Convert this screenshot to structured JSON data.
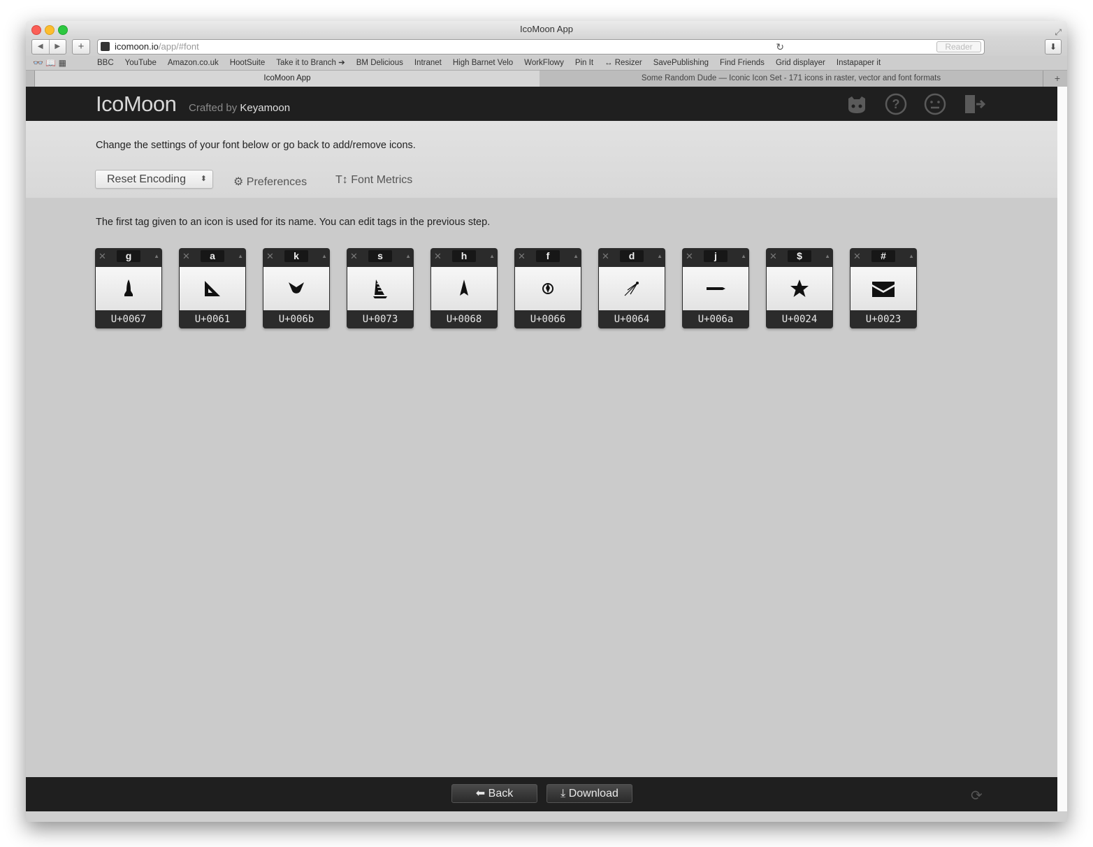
{
  "window": {
    "title": "IcoMoon App"
  },
  "browser": {
    "url_host": "icomoon.io",
    "url_path": "/app/#font",
    "reader_label": "Reader",
    "bookmarks": [
      "BBC",
      "YouTube",
      "Amazon.co.uk",
      "HootSuite",
      "Take it to Branch ➔",
      "BM Delicious",
      "Intranet",
      "High Barnet Velo",
      "WorkFlowy",
      "Pin It",
      "↔ Resizer",
      "SavePublishing",
      "Find Friends",
      "Grid displayer",
      "Instapaper it"
    ],
    "tabs": [
      {
        "label": "IcoMoon App"
      },
      {
        "label": "Some Random Dude — Iconic Icon Set - 171 icons in raster, vector and font formats"
      }
    ]
  },
  "header": {
    "logo": "IcoMoon",
    "crafted_by": "Crafted by",
    "author": "Keyamoon"
  },
  "settings": {
    "intro": "Change the settings of your font below or go back to add/remove icons.",
    "encoding_select": "Reset Encoding",
    "preferences_label": "Preferences",
    "font_metrics_label": "Font Metrics"
  },
  "content": {
    "intro": "The first tag given to an icon is used for its name. You can edit tags in the previous step.",
    "glyphs": [
      {
        "tag": "g",
        "code": "U+0067",
        "icon": "rocket-icon"
      },
      {
        "tag": "a",
        "code": "U+0061",
        "icon": "set-square-icon"
      },
      {
        "tag": "k",
        "code": "U+006b",
        "icon": "bird-icon"
      },
      {
        "tag": "s",
        "code": "U+0073",
        "icon": "ship-icon"
      },
      {
        "tag": "h",
        "code": "U+0068",
        "icon": "spaceship-icon"
      },
      {
        "tag": "f",
        "code": "U+0066",
        "icon": "ball-icon"
      },
      {
        "tag": "d",
        "code": "U+0064",
        "icon": "comet-icon"
      },
      {
        "tag": "j",
        "code": "U+006a",
        "icon": "missile-icon"
      },
      {
        "tag": "$",
        "code": "U+0024",
        "icon": "star-icon"
      },
      {
        "tag": "#",
        "code": "U+0023",
        "icon": "envelope-icon"
      }
    ]
  },
  "footer": {
    "back_label": "Back",
    "download_label": "Download"
  }
}
